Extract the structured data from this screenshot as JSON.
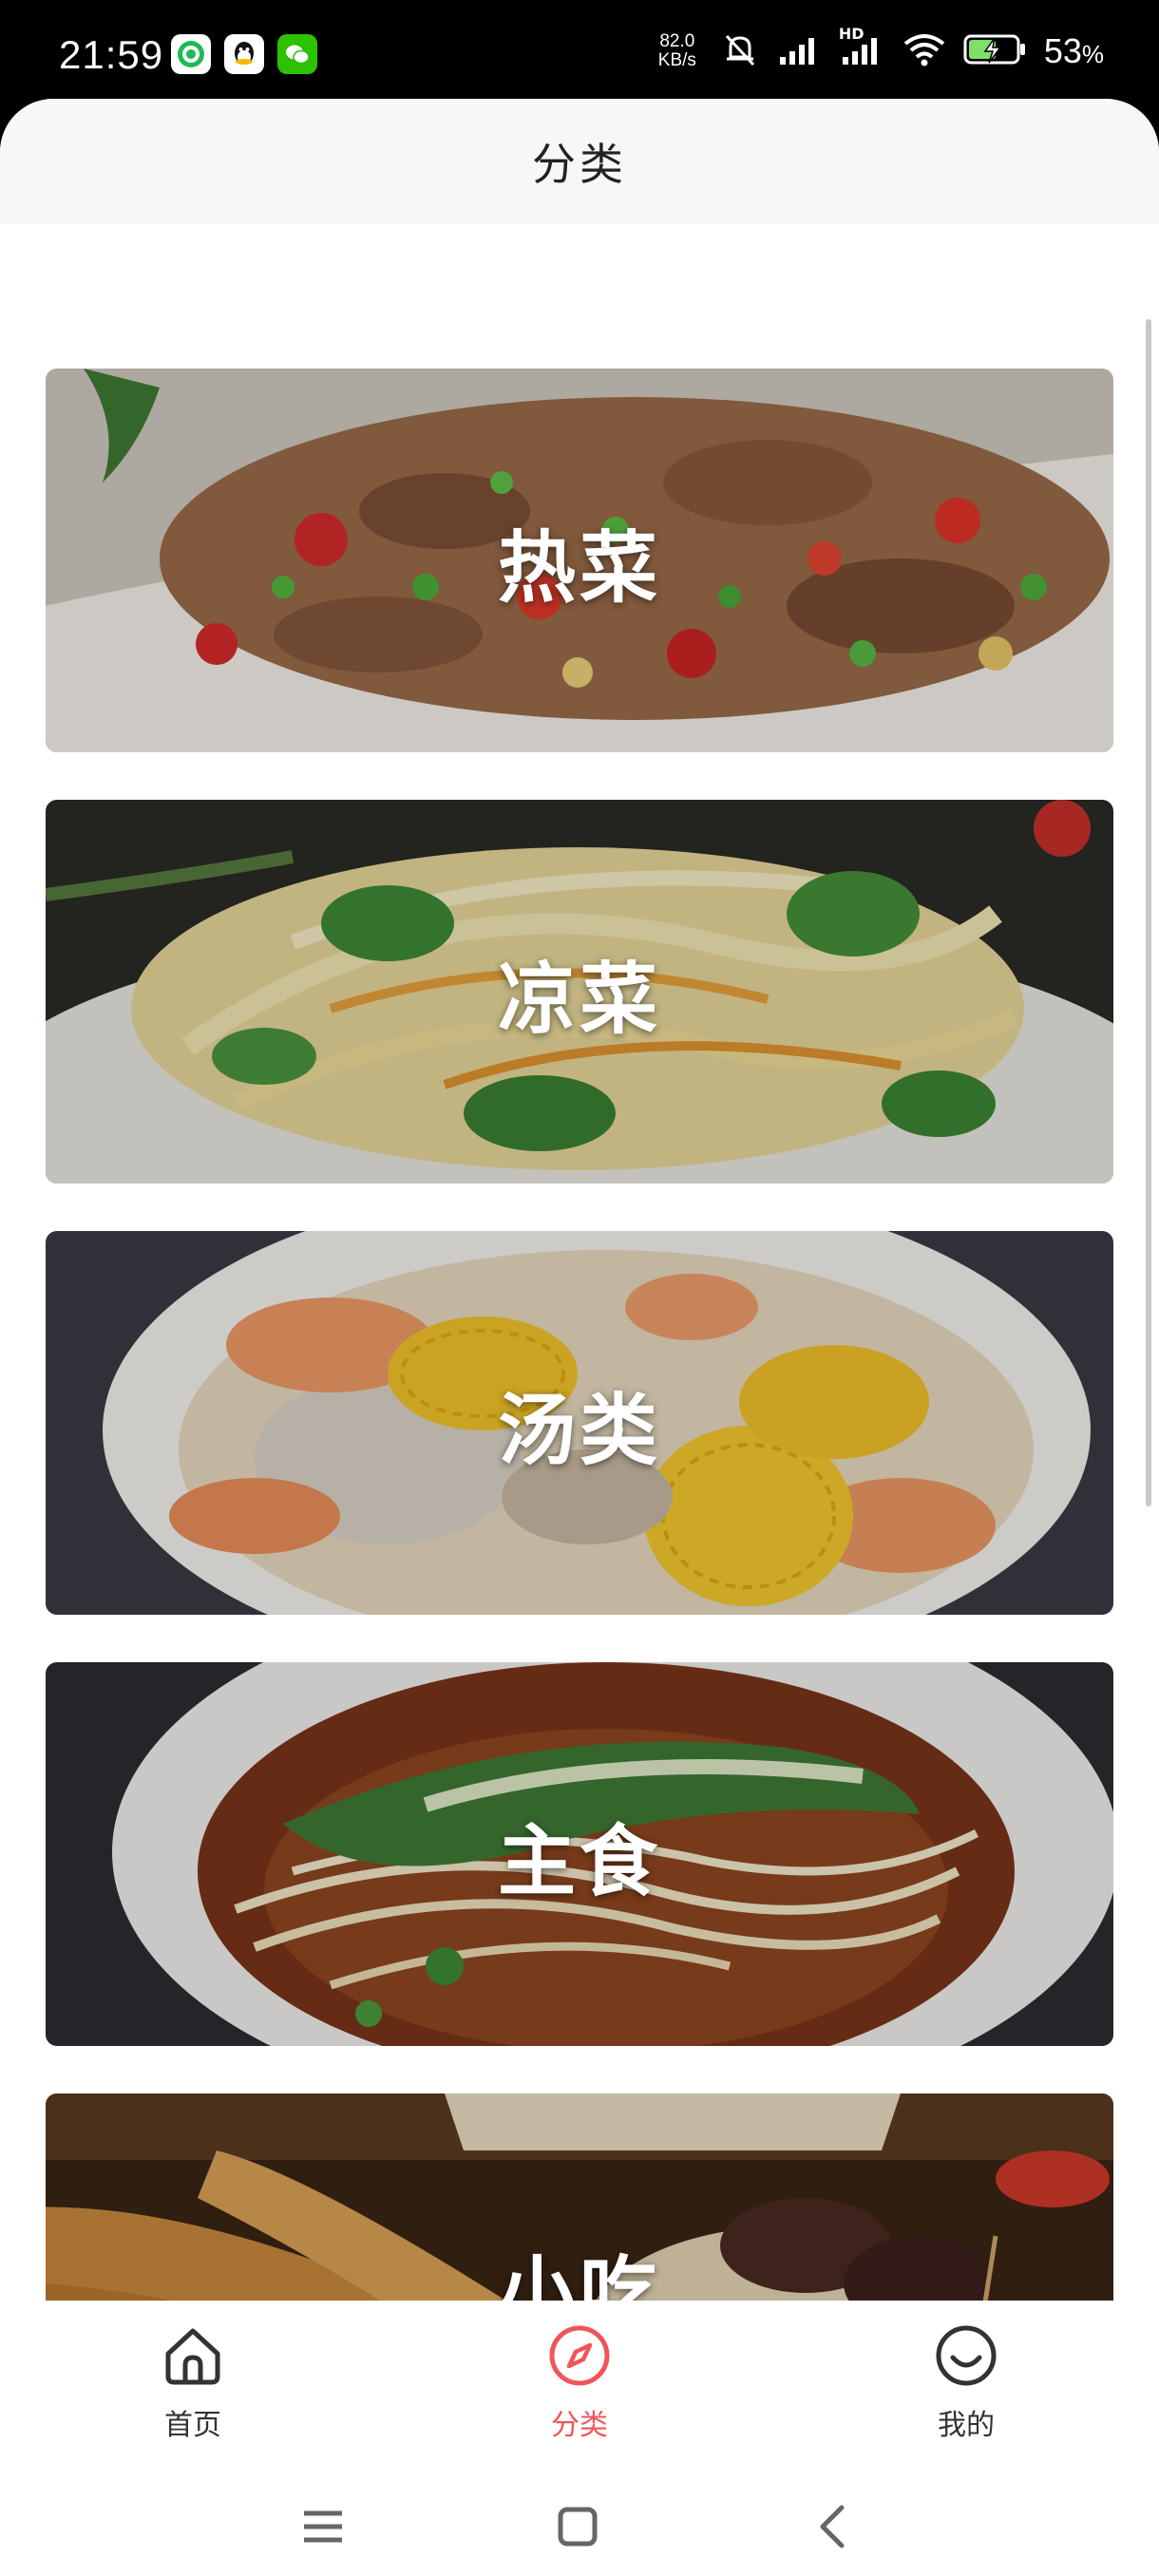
{
  "status_bar": {
    "time": "21:59",
    "network_speed_value": "82.0",
    "network_speed_unit": "KB/s",
    "signal_label": "HD",
    "battery_percent": "53",
    "battery_sign": "%",
    "app_icons": [
      "green-app-icon",
      "qq-icon",
      "wechat-icon"
    ]
  },
  "header": {
    "title": "分类"
  },
  "categories": [
    {
      "label": "热菜",
      "image": "stir-fried-meat-with-chili"
    },
    {
      "label": "凉菜",
      "image": "cold-vegetable-salad"
    },
    {
      "label": "汤类",
      "image": "corn-carrot-soup"
    },
    {
      "label": "主食",
      "image": "noodle-soup-bowl"
    },
    {
      "label": "小吃",
      "image": "fried-snacks"
    }
  ],
  "bottom_nav": {
    "items": [
      {
        "label": "首页",
        "icon": "home-icon",
        "active": false
      },
      {
        "label": "分类",
        "icon": "compass-icon",
        "active": true
      },
      {
        "label": "我的",
        "icon": "smiley-icon",
        "active": false
      }
    ],
    "active_color": "#f0555a",
    "inactive_color": "#333333"
  },
  "system_nav": {
    "buttons": [
      "menu-icon",
      "home-square-icon",
      "back-icon"
    ]
  }
}
